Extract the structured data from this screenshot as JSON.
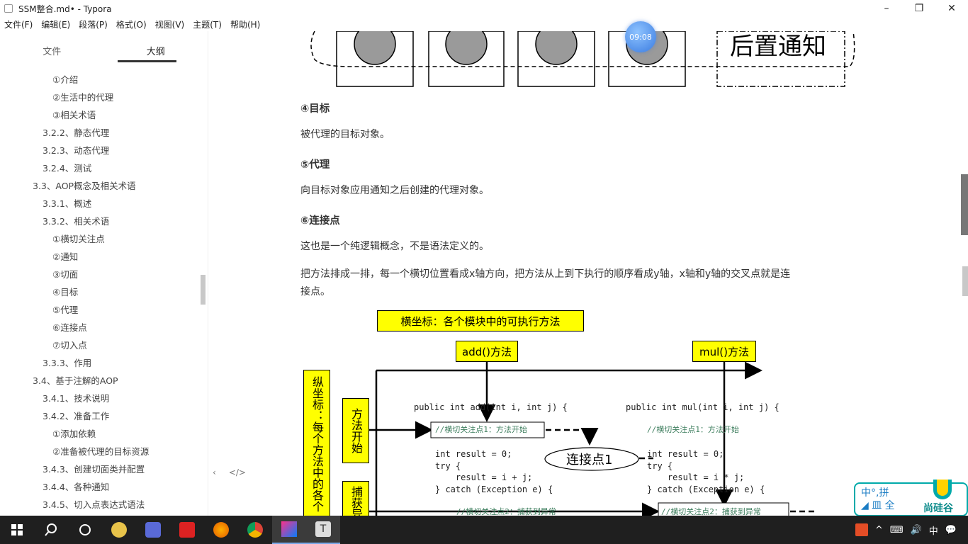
{
  "window": {
    "title": "SSM整合.md• - Typora",
    "buttons": {
      "minimize": "–",
      "maximize": "❐",
      "close": "✕"
    }
  },
  "menu": [
    "文件(F)",
    "编辑(E)",
    "段落(P)",
    "格式(O)",
    "视图(V)",
    "主题(T)",
    "帮助(H)"
  ],
  "sidebar": {
    "tabs": [
      "文件",
      "大纲"
    ],
    "active_tab": "大纲",
    "outline": [
      {
        "label": "①介绍",
        "level": 3
      },
      {
        "label": "②生活中的代理",
        "level": 3
      },
      {
        "label": "③相关术语",
        "level": 3
      },
      {
        "label": "3.2.2、静态代理",
        "level": 2
      },
      {
        "label": "3.2.3、动态代理",
        "level": 2
      },
      {
        "label": "3.2.4、测试",
        "level": 2
      },
      {
        "label": "3.3、AOP概念及相关术语",
        "level": 1
      },
      {
        "label": "3.3.1、概述",
        "level": 2
      },
      {
        "label": "3.3.2、相关术语",
        "level": 2
      },
      {
        "label": "①横切关注点",
        "level": 3
      },
      {
        "label": "②通知",
        "level": 3
      },
      {
        "label": "③切面",
        "level": 3
      },
      {
        "label": "④目标",
        "level": 3
      },
      {
        "label": "⑤代理",
        "level": 3
      },
      {
        "label": "⑥连接点",
        "level": 3
      },
      {
        "label": "⑦切入点",
        "level": 3
      },
      {
        "label": "3.3.3、作用",
        "level": 2
      },
      {
        "label": "3.4、基于注解的AOP",
        "level": 1
      },
      {
        "label": "3.4.1、技术说明",
        "level": 2
      },
      {
        "label": "3.4.2、准备工作",
        "level": 2
      },
      {
        "label": "①添加依赖",
        "level": 3
      },
      {
        "label": "②准备被代理的目标资源",
        "level": 3
      },
      {
        "label": "3.4.3、创建切面类并配置",
        "level": 2
      },
      {
        "label": "3.4.4、各种通知",
        "level": 2
      },
      {
        "label": "3.4.5、切入点表达式语法",
        "level": 2
      }
    ],
    "footer": [
      "‹",
      "</>"
    ]
  },
  "editor": {
    "top_diagram_label": "后置通知",
    "time_badge": "09:08",
    "sections": [
      {
        "heading": "④目标",
        "text": "被代理的目标对象。"
      },
      {
        "heading": "⑤代理",
        "text": "向目标对象应用通知之后创建的代理对象。"
      },
      {
        "heading": "⑥连接点",
        "text": "这也是一个纯逻辑概念，不是语法定义的。"
      }
    ],
    "paragraph_long": [
      "把方法排成一排，每一个横切位置看成x轴方向，把方法从上到下执行的顺序看成y轴，x轴和y轴的交叉点就是连",
      "接点。"
    ],
    "diagram": {
      "x_axis_label": "横坐标：各个模块中的可执行方法",
      "y_axis_label": "纵坐标：每个方法中的各个",
      "method_add": "add()方法",
      "method_mul": "mul()方法",
      "step_start": "方法开始",
      "step_catch": "捕获异",
      "join_point": "连接点1",
      "code_add": {
        "sig": "public int add(int i, int j) {",
        "comment": "//横切关注点1：方法开始",
        "body": [
          "int result = 0;",
          "try {",
          "    result = i + j;",
          "} catch (Exception e) {"
        ],
        "comment2": "//横切关注点2：捕获到异常"
      },
      "code_mul": {
        "sig": "public int mul(int i, int j) {",
        "comment": "//横切关注点1：方法开始",
        "body": [
          "int result = 0;",
          "try {",
          "    result = i * j;",
          "} catch (Exception e) {"
        ],
        "comment2": "//横切关注点2：捕获到异常"
      }
    }
  },
  "watermark": {
    "left": "中°,拼\n◢ 皿 全",
    "brand": "尚硅谷"
  },
  "taskbar": {
    "apps": [
      "windows-start",
      "search",
      "task-view",
      "app-1",
      "app-2",
      "app-3",
      "firefox",
      "chrome",
      "intellij",
      "typora"
    ],
    "tray": [
      "^",
      "⌨",
      "🔊",
      "中",
      "💬"
    ]
  }
}
